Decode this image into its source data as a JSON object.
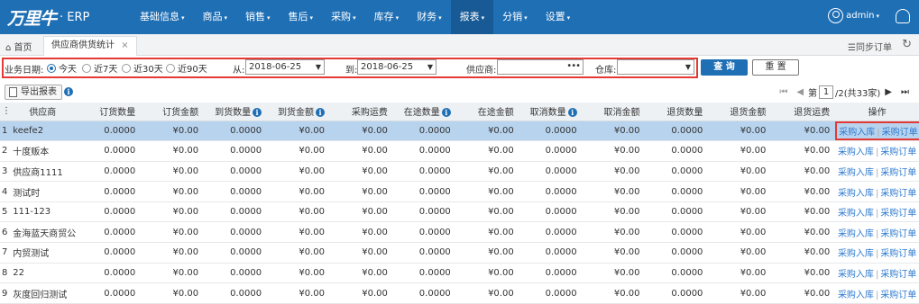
{
  "app": {
    "logo": "万里牛",
    "name": "ERP"
  },
  "nav": [
    {
      "label": "基础信息",
      "caret": true
    },
    {
      "label": "商品",
      "caret": true
    },
    {
      "label": "销售",
      "caret": true
    },
    {
      "label": "售后",
      "caret": true
    },
    {
      "label": "采购",
      "caret": true
    },
    {
      "label": "库存",
      "caret": true
    },
    {
      "label": "财务",
      "caret": true
    },
    {
      "label": "报表",
      "caret": true,
      "active": true
    },
    {
      "label": "分销",
      "caret": true
    },
    {
      "label": "设置",
      "caret": true
    }
  ],
  "user": {
    "name": "admin"
  },
  "tabs": {
    "home": "首页",
    "active": "供应商供货统计",
    "sync": "同步订单"
  },
  "filter": {
    "date_label": "业务日期:",
    "radios": [
      "今天",
      "近7天",
      "近30天",
      "近90天"
    ],
    "from_label": "从:",
    "from_value": "2018-06-25",
    "to_label": "到:",
    "to_value": "2018-06-25",
    "supplier_label": "供应商:",
    "warehouse_label": "仓库:",
    "query": "查 询",
    "reset": "重 置"
  },
  "toolbar": {
    "export": "导出报表"
  },
  "pager": {
    "page_label": "第",
    "page": "1",
    "total": "/2(共33家)"
  },
  "columns": [
    "供应商",
    "订货数量",
    "订货金额",
    "到货数量",
    "到货金额",
    "采购运费",
    "在途数量",
    "在途金额",
    "取消数量",
    "取消金额",
    "退货数量",
    "退货金额",
    "退货运费",
    "操作"
  ],
  "info_columns": [
    3,
    4,
    6,
    8
  ],
  "ops": {
    "in": "采购入库",
    "order": "采购订单"
  },
  "rows": [
    {
      "idx": "1",
      "name": "keefe2"
    },
    {
      "idx": "2",
      "name": "十度贩本"
    },
    {
      "idx": "3",
      "name": "供应商1111"
    },
    {
      "idx": "4",
      "name": "测试时"
    },
    {
      "idx": "5",
      "name": "111-123"
    },
    {
      "idx": "6",
      "name": "金海蓝天商贸公"
    },
    {
      "idx": "7",
      "name": "内贸测试"
    },
    {
      "idx": "8",
      "name": "22"
    },
    {
      "idx": "9",
      "name": "灰度回归测试"
    }
  ],
  "row_values": [
    "0.0000",
    "¥0.00",
    "0.0000",
    "¥0.00",
    "¥0.00",
    "0.0000",
    "¥0.00",
    "0.0000",
    "¥0.00",
    "0.0000",
    "¥0.00",
    "¥0.00"
  ]
}
